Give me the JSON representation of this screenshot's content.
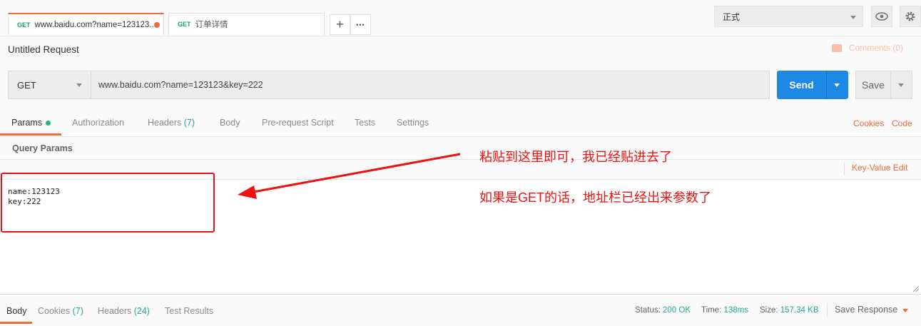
{
  "tabs": [
    {
      "method": "GET",
      "title": "www.baidu.com?name=123123..."
    },
    {
      "method": "GET",
      "title": "订单详情"
    }
  ],
  "tab_actions": {
    "new_tab": "+",
    "more": "•••"
  },
  "environment": {
    "selected": "正式"
  },
  "request": {
    "title": "Untitled Request",
    "comments": "Comments (0)",
    "method": "GET",
    "url": "www.baidu.com?name=123123&key=222",
    "send_label": "Send",
    "save_label": "Save"
  },
  "request_tabs": [
    {
      "label": "Params",
      "count": ""
    },
    {
      "label": "Authorization",
      "count": ""
    },
    {
      "label": "Headers",
      "count": "(7)"
    },
    {
      "label": "Body",
      "count": ""
    },
    {
      "label": "Pre-request Script",
      "count": ""
    },
    {
      "label": "Tests",
      "count": ""
    },
    {
      "label": "Settings",
      "count": ""
    }
  ],
  "request_links": {
    "cookies": "Cookies",
    "code": "Code"
  },
  "params": {
    "heading": "Query Params",
    "key_value_edit": "Key-Value Edit",
    "bulk_text": "name:123123\nkey:222"
  },
  "annotation": {
    "line1": "粘贴到这里即可，我已经贴进去了",
    "line2": "如果是GET的话，地址栏已经出来参数了"
  },
  "response_tabs": [
    {
      "label": "Body",
      "count": ""
    },
    {
      "label": "Cookies",
      "count": "(7)"
    },
    {
      "label": "Headers",
      "count": "(24)"
    },
    {
      "label": "Test Results",
      "count": ""
    }
  ],
  "response_status": {
    "status_label": "Status:",
    "status_value": "200 OK",
    "time_label": "Time:",
    "time_value": "138ms",
    "size_label": "Size:",
    "size_value": "157.34 KB",
    "save_response": "Save Response"
  },
  "colors": {
    "accent": "#f26b3a",
    "send": "#1e88e5",
    "annotation": "#ee1111",
    "green": "#26a69a"
  }
}
